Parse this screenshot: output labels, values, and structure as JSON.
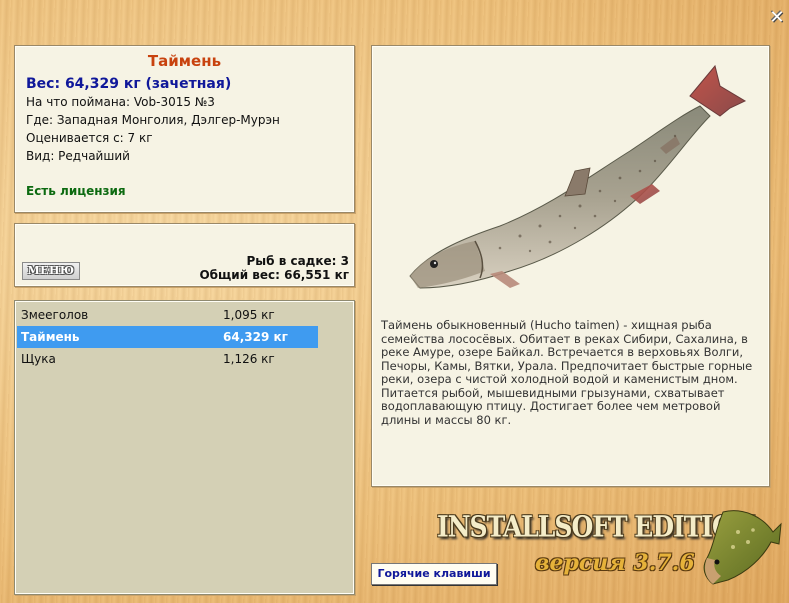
{
  "fish_card": {
    "title": "Таймень",
    "weight": "Вес: 64,329 кг (зачетная)",
    "bait": "На что поймана: Vob-3015 №3",
    "where": "Где: Западная Монголия, Дэлгер-Мурэн",
    "value": "Оценивается с: 7 кг",
    "kind": "Вид: Редчайший",
    "license": "Есть лицензия"
  },
  "cage": {
    "menu_label": "МЕНЮ",
    "fish_count": "Рыб в садке: 3",
    "total_weight": "Общий вес: 66,551 кг"
  },
  "list": {
    "items": [
      {
        "name": "Змееголов",
        "weight": "1,095 кг",
        "selected": false
      },
      {
        "name": "Таймень",
        "weight": "64,329 кг",
        "selected": true
      },
      {
        "name": "Щука",
        "weight": "1,126 кг",
        "selected": false
      }
    ]
  },
  "description": "Таймень обыкновенный (Hucho taimen) - хищная рыба семейства лососёвых. Обитает в реках Сибири, Сахалина, в реке Амуре, озере Байкал. Встречается в верховьях Волги, Печоры, Камы, Вятки, Урала. Предпочитает быстрые горные реки, озера с чистой холодной водой и каменистым дном. Питается рыбой, мышевидными грызунами, схватывает водоплавающую птицу. Достигает более чем метровой длины и массы 80 кг.",
  "branding": {
    "edition": "INSTALLSOFT EDITION",
    "version": "версия 3.7.6",
    "hotkeys_label": "Горячие клавиши"
  },
  "icons": {
    "close": "close-icon",
    "fish": "taimen-fish-image",
    "pike": "pike-logo"
  },
  "colors": {
    "title": "#c8420e",
    "weight": "#10189a",
    "license": "#0c6a10",
    "selection": "#3f9bf0"
  }
}
